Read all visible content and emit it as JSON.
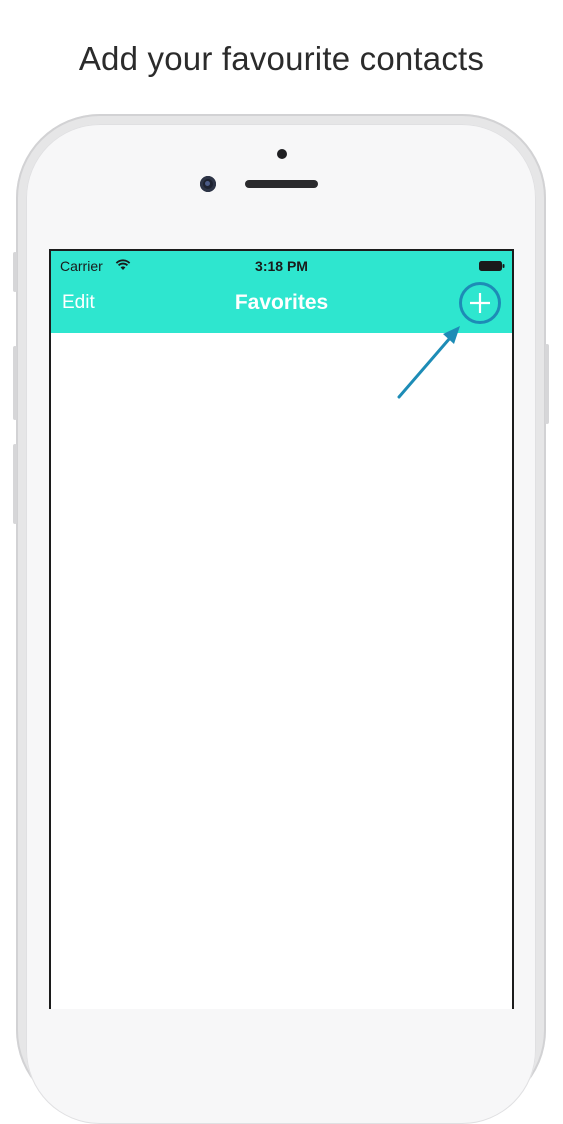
{
  "caption": "Add your favourite contacts",
  "status_bar": {
    "carrier": "Carrier",
    "time": "3:18 PM",
    "wifi_icon": "wifi-icon",
    "battery_icon": "battery-icon"
  },
  "nav_bar": {
    "edit_label": "Edit",
    "title": "Favorites",
    "add_icon": "plus-icon"
  },
  "colors": {
    "nav_background": "#2ee6cf",
    "highlight": "#1d8cb6",
    "nav_text": "#ffffff"
  }
}
